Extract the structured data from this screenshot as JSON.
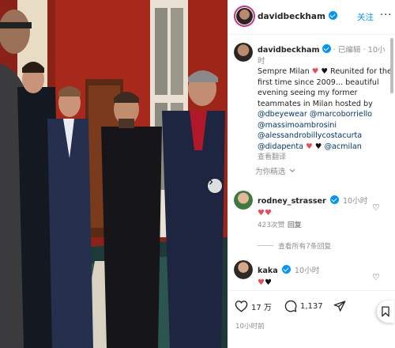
{
  "post": {
    "username": "davidbeckham",
    "follow_label": "关注",
    "more_label": "···",
    "caption": {
      "username": "davidbeckham",
      "edited_label": "已编辑",
      "time": "10小时",
      "text_1": "Sempre Milan",
      "text_2": "Reunited for the first time since 2009... beautiful evening seeing my former teammates in Milan hosted by",
      "mentions": [
        "@dbeyewear",
        "@marcoborriello",
        "@massimoambrosini",
        "@alessandrobillycostacurta",
        "@didapenta",
        "@acmilan"
      ],
      "translate_label": "查看翻译"
    },
    "more_for_you_label": "为你精选",
    "comments": [
      {
        "username": "rodney_strasser",
        "time": "10小时",
        "likes": "423次赞",
        "reply_label": "回复",
        "view_replies_label": "查看所有7条回复"
      },
      {
        "username": "kaka",
        "time": "10小时"
      }
    ],
    "actions": {
      "likes": "17 万",
      "comments": "1,137"
    },
    "timestamp": "10小时前"
  },
  "colors": {
    "accent_blue": "#0095f6",
    "heart_red": "#ed4956",
    "meta_gray": "#8e8e8e",
    "mention_blue": "#00376b"
  },
  "icons": [
    "verified-badge-icon",
    "heart-icon",
    "comment-icon",
    "share-icon",
    "bookmark-icon",
    "chevron-down-icon",
    "chevron-right-icon"
  ]
}
